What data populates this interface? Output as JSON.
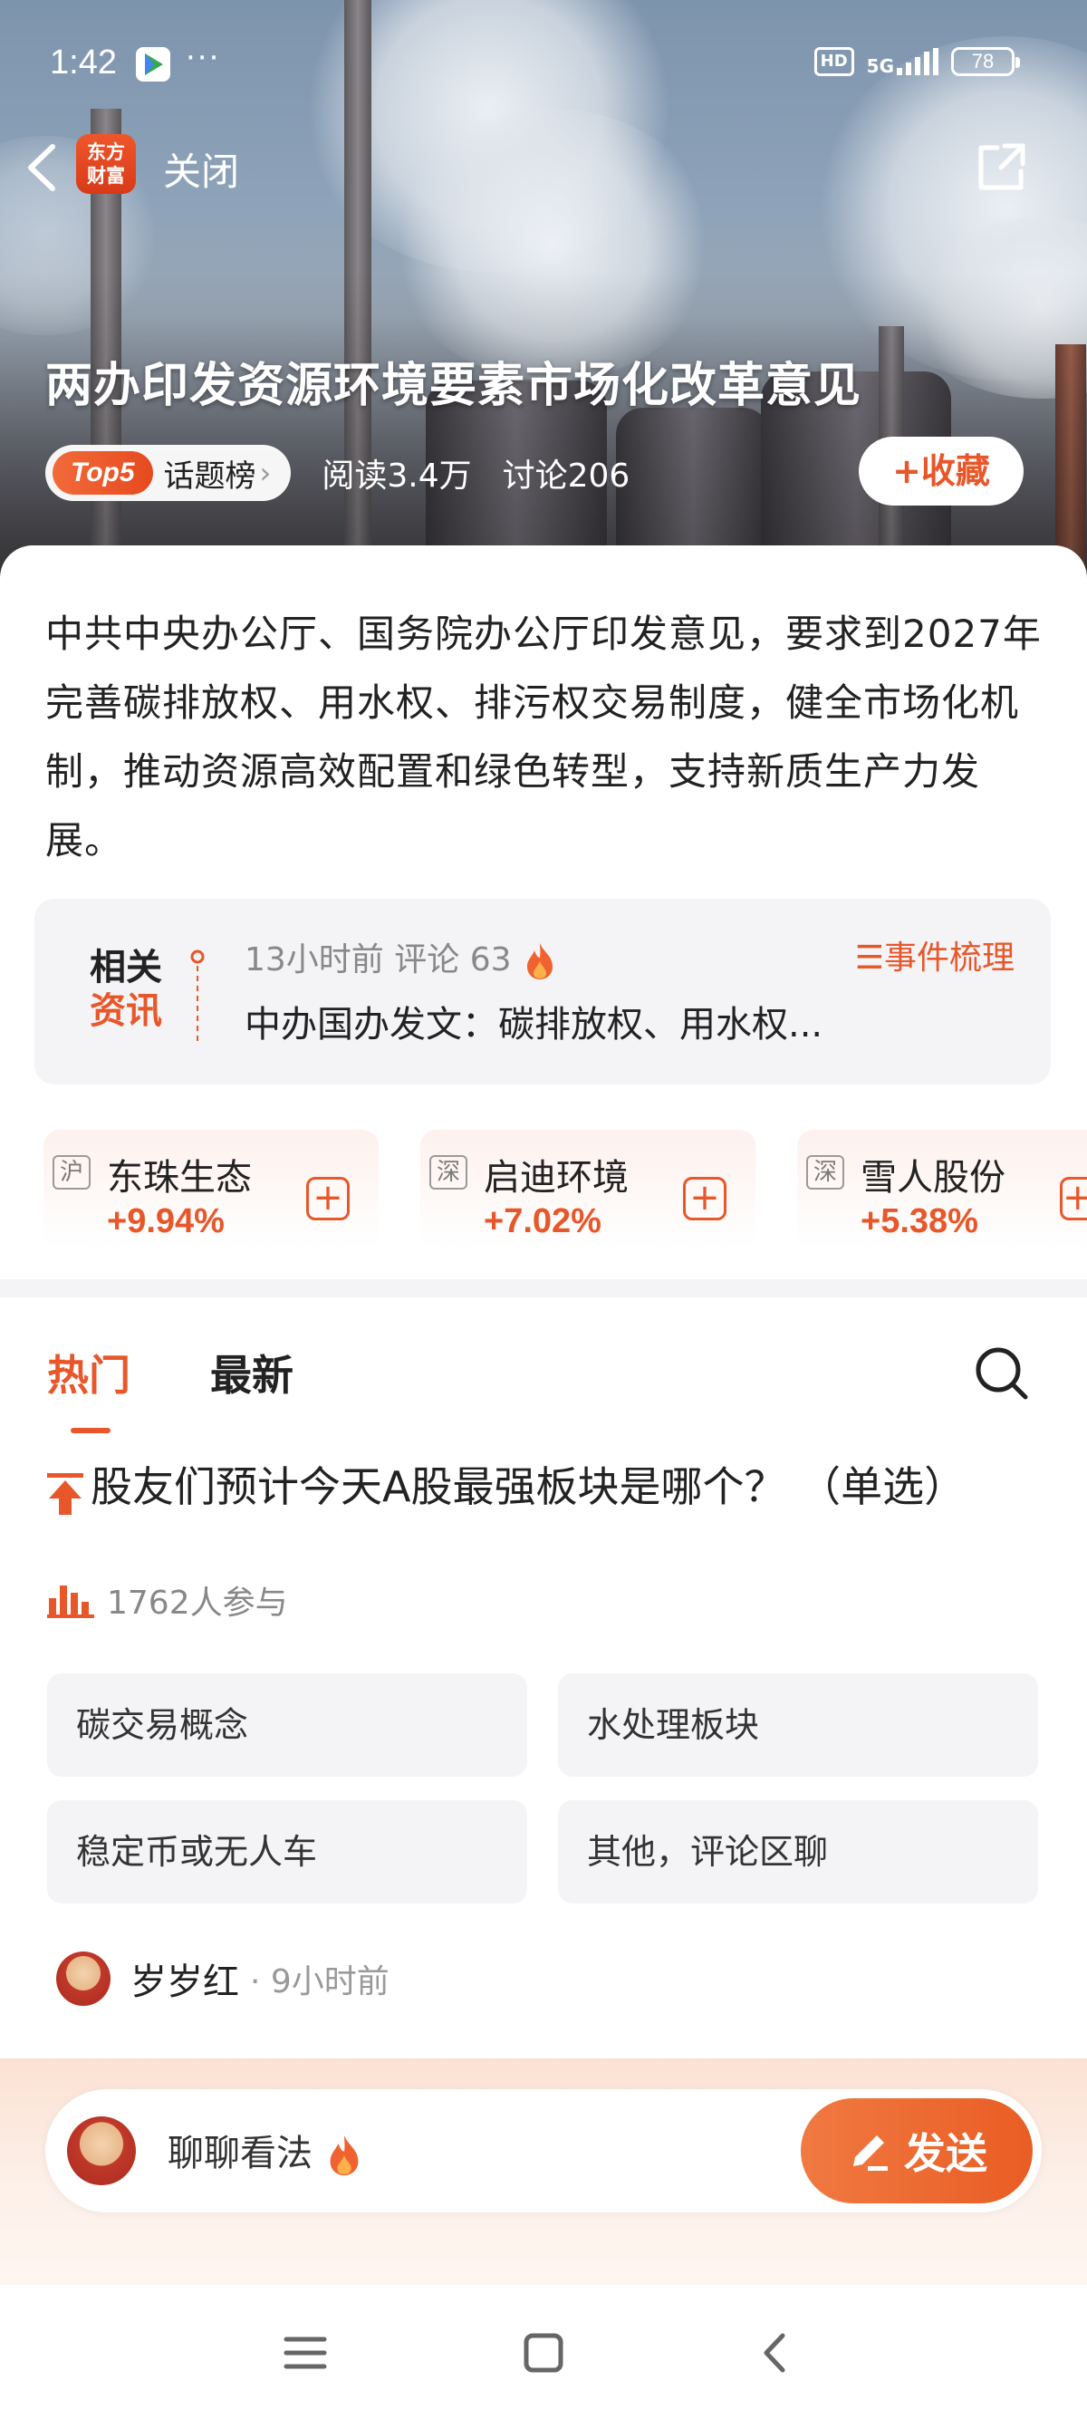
{
  "status_bar": {
    "time": "1:42",
    "dots": "···",
    "hd": "HD",
    "signal": "5G",
    "battery": "78"
  },
  "nav": {
    "app_logo_line1": "东方",
    "app_logo_line2": "财富",
    "close_label": "关闭"
  },
  "hero": {
    "title": "两办印发资源环境要素市场化改革意见",
    "top_rank": "Top5",
    "topic_board": "话题榜",
    "topic_arrow": "›",
    "reads": "阅读3.4万",
    "discussions": "讨论206",
    "favorite_label": "+收藏"
  },
  "summary": "中共中央办公厅、国务院办公厅印发意见，要求到2027年完善碳排放权、用水权、排污权交易制度，健全市场化机制，推动资源高效配置和绿色转型，支持新质生产力发展。",
  "related_news": {
    "label_line1": "相关",
    "label_line2": "资讯",
    "meta": "13小时前  评论 63",
    "event_link": "☰事件梳理",
    "headline": "中办国办发文：碳排放权、用水权..."
  },
  "stocks": [
    {
      "market": "沪",
      "name": "东珠生态",
      "change": "+9.94%"
    },
    {
      "market": "深",
      "name": "启迪环境",
      "change": "+7.02%"
    },
    {
      "market": "深",
      "name": "雪人股份",
      "change": "+5.38%"
    }
  ],
  "tabs": {
    "hot": "热门",
    "latest": "最新"
  },
  "poll": {
    "title": "股友们预计今天A股最强板块是哪个？  （单选）",
    "participants": "1762人参与",
    "options": [
      "碳交易概念",
      "水处理板块",
      "稳定币或无人车",
      "其他，评论区聊"
    ]
  },
  "comment": {
    "user": "岁岁红",
    "time": "· 9小时前"
  },
  "input": {
    "placeholder": "聊聊看法",
    "send_label": "发送"
  },
  "colors": {
    "accent": "#e8572a",
    "card_bg": "#f4f4f7"
  }
}
